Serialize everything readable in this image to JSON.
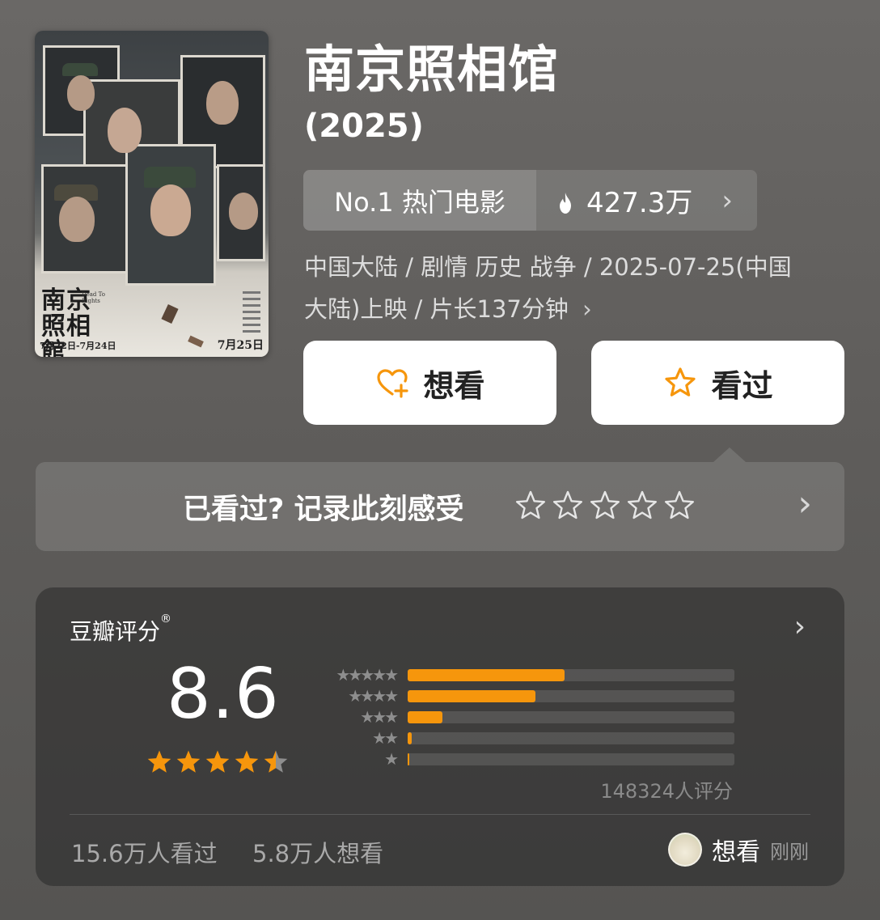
{
  "movie": {
    "title": "南京照相馆",
    "year": "(2025)",
    "meta_line1": "中国大陆 / 剧情 历史 战争 / 2025-07-25(中国",
    "meta_line2": "大陆)上映 / 片长137分钟",
    "meta_chevron": "›"
  },
  "poster": {
    "title_text": "南京照相館",
    "subtitle_en": "Dead To Rights",
    "dates": "7月22日-7月24日",
    "release": "7月25日"
  },
  "rank_chip": {
    "label": "No.1 热门电影",
    "heat": "427.3万",
    "chevron": "›"
  },
  "buttons": {
    "want_label": "想看",
    "seen_label": "看过"
  },
  "record": {
    "prompt": "已看过? 记录此刻感受",
    "chevron": "›"
  },
  "rating": {
    "label": "豆瓣评分",
    "mark": "®",
    "chevron": "›",
    "score": "8.6",
    "stars_shown": 4.5,
    "distribution": [
      {
        "stars": 5,
        "star_text": "★★★★★",
        "fraction": 0.48
      },
      {
        "stars": 4,
        "star_text": "★★★★",
        "fraction": 0.39
      },
      {
        "stars": 3,
        "star_text": "★★★",
        "fraction": 0.107
      },
      {
        "stars": 2,
        "star_text": "★★",
        "fraction": 0.012
      },
      {
        "stars": 1,
        "star_text": "★",
        "fraction": 0.006
      }
    ],
    "votes": "148324人评分",
    "watched": "15.6万人看过",
    "wish": "5.8万人想看",
    "friend_action": "想看",
    "friend_time": "刚刚"
  },
  "colors": {
    "accent": "#f6960c",
    "star_empty": "#8e8e8e",
    "button_bg": "#ffffff"
  },
  "icons": [
    "heart-plus-icon",
    "star-outline-icon",
    "flame-icon",
    "chevron-right-icon",
    "star-icon"
  ]
}
